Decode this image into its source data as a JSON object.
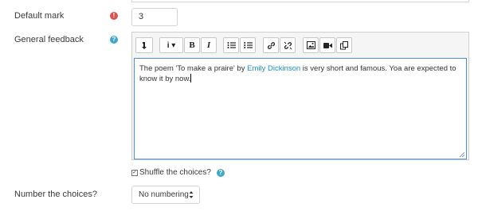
{
  "default_mark": {
    "label": "Default mark",
    "required_icon": "exclamation-icon",
    "value": "3"
  },
  "general_feedback": {
    "label": "General feedback",
    "help_icon": "question-icon",
    "toolbar": [
      {
        "name": "toggle-toolbar-icon"
      },
      {
        "name": "paragraph-styles-icon",
        "text": "i ▾"
      },
      {
        "name": "bold-button",
        "text": "B"
      },
      {
        "name": "italic-button",
        "text": "I"
      },
      {
        "name": "unordered-list-icon"
      },
      {
        "name": "ordered-list-icon"
      },
      {
        "name": "link-icon"
      },
      {
        "name": "unlink-icon"
      },
      {
        "name": "image-icon"
      },
      {
        "name": "video-icon"
      },
      {
        "name": "manage-files-icon"
      }
    ],
    "content": {
      "before": "The poem 'To make a praire' by ",
      "link": "Emily Dickinson",
      "after": " is very short and famous.  Yoa are expected to know it by now."
    }
  },
  "shuffle": {
    "label": "Shuffle the choices?",
    "checked": true,
    "help_icon": "question-icon"
  },
  "numbering": {
    "label": "Number the choices?",
    "selected": "No numbering"
  },
  "colors": {
    "required": "#d9534f",
    "help": "#3fa7c9",
    "link": "#1a8fc4",
    "editor_focus": "#4a90d9"
  }
}
